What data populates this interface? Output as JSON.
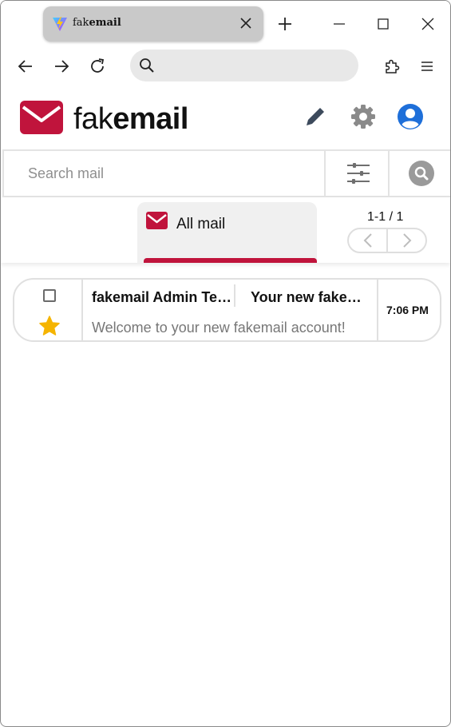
{
  "browser": {
    "tab": {
      "title_prefix": "fak",
      "title_bold": "email",
      "favicon": "vite-icon",
      "close_icon": "close-icon"
    },
    "new_tab_icon": "plus-icon",
    "window_controls": [
      "minimize-icon",
      "maximize-icon",
      "close-icon"
    ],
    "nav": {
      "back": "arrow-left-icon",
      "forward": "arrow-right-icon",
      "reload": "reload-icon"
    },
    "address_bar": {
      "value": "",
      "placeholder": "",
      "icon": "search-icon"
    },
    "extensions_icon": "puzzle-icon",
    "menu_icon": "hamburger-menu-icon"
  },
  "app": {
    "brand_light": "fak",
    "brand_bold": "email",
    "logo": "envelope-logo",
    "header_icons": [
      "pencil-icon",
      "gear-icon",
      "user-account-icon"
    ],
    "colors": {
      "brand": "#c0143c",
      "icon_dark": "#3d4a5c",
      "icon_gray": "#8a8a8a",
      "account_blue": "#1e6fd9",
      "star": "#f5b400"
    }
  },
  "search": {
    "placeholder": "Search mail",
    "value": "",
    "filter_icon": "sliders-icon",
    "search_icon": "search-icon"
  },
  "folders": {
    "active": {
      "label": "All mail",
      "icon": "envelope-icon"
    },
    "pagination": {
      "text": "1-1 / 1",
      "prev_icon": "chevron-left-icon",
      "next_icon": "chevron-right-icon"
    }
  },
  "emails": [
    {
      "checked": false,
      "starred": true,
      "sender": "fakemail Admin Team",
      "subject": "Your new fakemail account",
      "preview": "Welcome to your new fakemail account!",
      "time": "7:06 PM"
    }
  ]
}
